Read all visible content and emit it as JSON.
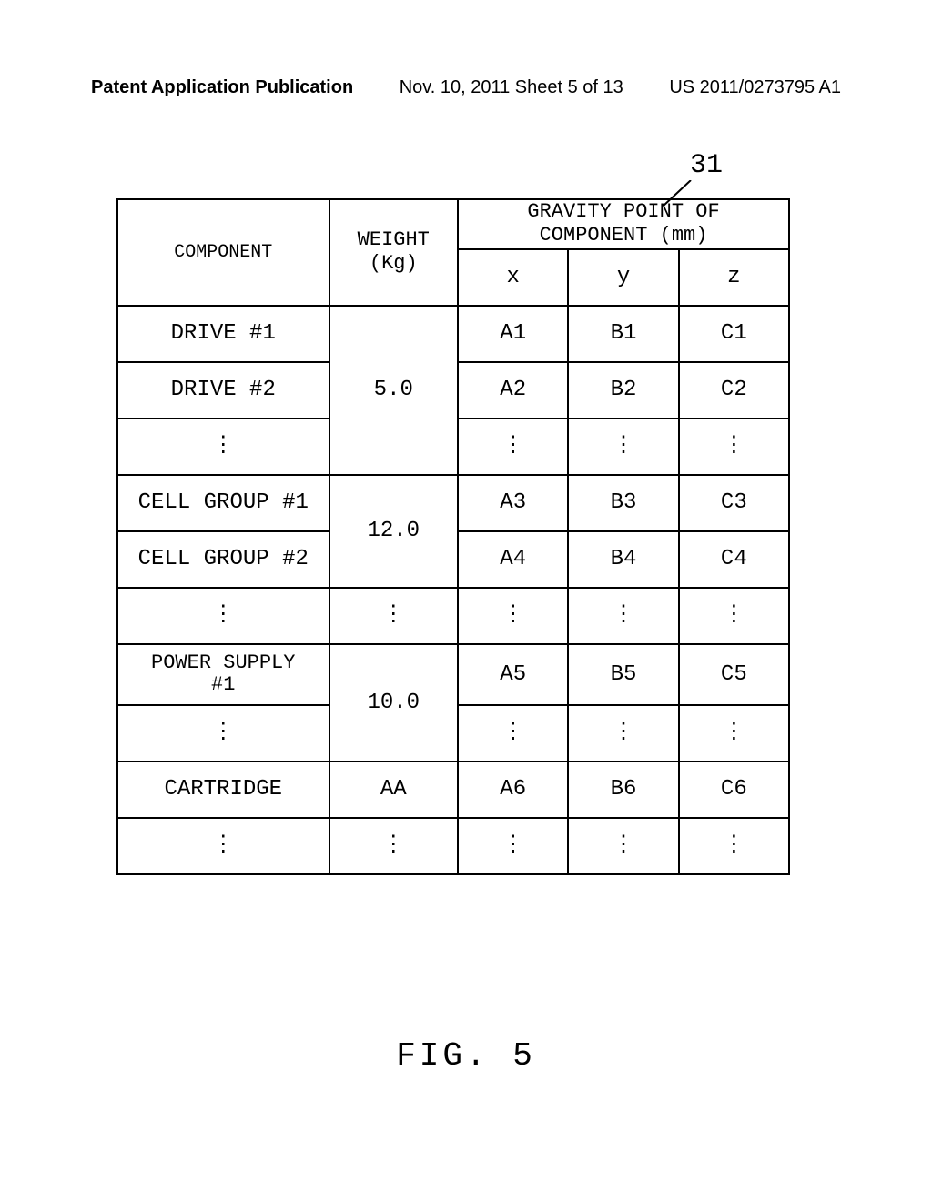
{
  "header": {
    "left": "Patent Application Publication",
    "center": "Nov. 10, 2011  Sheet 5 of 13",
    "right": "US 2011/0273795 A1"
  },
  "ref_number": "31",
  "table": {
    "headers": {
      "component": "COMPONENT",
      "weight": "WEIGHT\n(Kg)",
      "gravity": "GRAVITY POINT OF\nCOMPONENT (mm)",
      "x": "x",
      "y": "y",
      "z": "z"
    },
    "rows": {
      "drive1": {
        "component": "DRIVE #1",
        "x": "A1",
        "y": "B1",
        "z": "C1"
      },
      "drive2": {
        "component": "DRIVE #2",
        "x": "A2",
        "y": "B2",
        "z": "C2"
      },
      "drive_weight": "5.0",
      "cell1": {
        "component": "CELL GROUP #1",
        "x": "A3",
        "y": "B3",
        "z": "C3"
      },
      "cell2": {
        "component": "CELL GROUP #2",
        "x": "A4",
        "y": "B4",
        "z": "C4"
      },
      "cell_weight": "12.0",
      "power1": {
        "component": "POWER SUPPLY\n#1",
        "x": "A5",
        "y": "B5",
        "z": "C5"
      },
      "power_weight": "10.0",
      "cartridge": {
        "component": "CARTRIDGE",
        "weight": "AA",
        "x": "A6",
        "y": "B6",
        "z": "C6"
      }
    }
  },
  "figure_caption": "FIG. 5",
  "vdots": "⋮"
}
